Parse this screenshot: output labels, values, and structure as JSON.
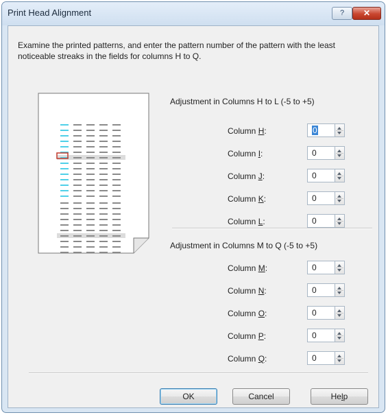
{
  "window": {
    "title": "Print Head Alignment",
    "help_icon": "question-mark-icon",
    "close_icon": "close-icon",
    "help_glyph": "?",
    "close_glyph": "✕"
  },
  "instruction": "Examine the printed patterns, and enter the pattern number of the pattern with the least noticeable streaks in the fields for columns H to Q.",
  "group1": {
    "title": "Adjustment in Columns H to L (-5 to +5)",
    "columns": [
      {
        "prefix": "Column ",
        "key": "H",
        "suffix": ":",
        "value": "0",
        "focused": true
      },
      {
        "prefix": "Column ",
        "key": "I",
        "suffix": ":",
        "value": "0"
      },
      {
        "prefix": "Column ",
        "key": "J",
        "suffix": ":",
        "value": "0"
      },
      {
        "prefix": "Column ",
        "key": "K",
        "suffix": ":",
        "value": "0"
      },
      {
        "prefix": "Column ",
        "key": "L",
        "suffix": ":",
        "value": "0"
      }
    ]
  },
  "group2": {
    "title": "Adjustment in Columns M to Q (-5 to +5)",
    "columns": [
      {
        "prefix": "Column ",
        "key": "M",
        "suffix": ":",
        "value": "0"
      },
      {
        "prefix": "Column ",
        "key": "N",
        "suffix": ":",
        "value": "0"
      },
      {
        "prefix": "Column ",
        "key": "O",
        "suffix": ":",
        "value": "0"
      },
      {
        "prefix": "Column ",
        "key": "P",
        "suffix": ":",
        "value": "0"
      },
      {
        "prefix": "Column ",
        "key": "Q",
        "suffix": ":",
        "value": "0"
      }
    ]
  },
  "buttons": {
    "ok": "OK",
    "cancel": "Cancel",
    "help_prefix": "He",
    "help_key": "l",
    "help_suffix": "p"
  },
  "colors": {
    "pattern_highlight": "#4fd0e8",
    "pattern_dash": "#8a8a8a",
    "selection_box": "#c0392b",
    "selection_fill": "#3b86d6"
  }
}
